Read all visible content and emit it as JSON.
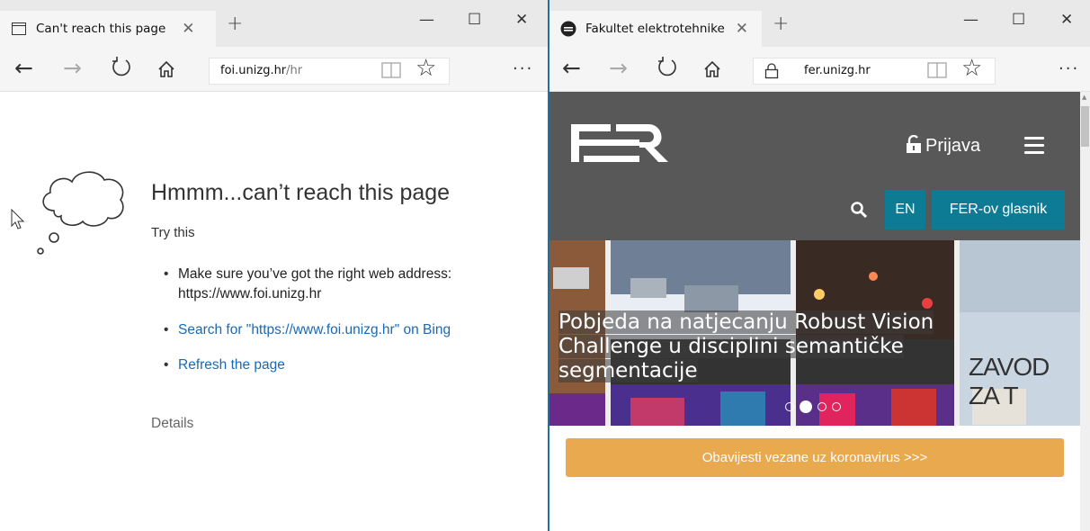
{
  "left_window": {
    "tab_title": "Can't reach this page",
    "new_tab": "+",
    "address_domain": "foi.unizg.hr",
    "address_path": "/hr",
    "error": {
      "title": "Hmmm...can’t reach this page",
      "try_this": "Try this",
      "items": [
        {
          "line1": "Make sure you’ve got the right web address:",
          "line2": "https://www.foi.unizg.hr"
        },
        {
          "text": "Search for \"https://www.foi.unizg.hr\" on Bing"
        },
        {
          "text": "Refresh the page"
        }
      ],
      "details": "Details"
    }
  },
  "right_window": {
    "tab_title": "Fakultet elektrotehnike",
    "new_tab": "+",
    "address_domain": "fer.unizg.hr",
    "site": {
      "prijava": "Prijava",
      "lang_button": "EN",
      "glasnik_button": "FER-ov glasnik",
      "headline_lines": [
        "Pobjeda na natjecanju Robust Vision",
        "Challenge u disciplini semantičke",
        "segmentacije"
      ],
      "side_slide_text": "ZAVOD ZA T",
      "corona_banner": "Obavijesti vezane uz koronavirus >>>",
      "slider_index": 2,
      "slider_total": 4
    }
  },
  "colors": {
    "fer_header": "#585858",
    "fer_teal": "#0d7b93",
    "corona_orange": "#e9a94e",
    "link_blue": "#1a69b5"
  }
}
